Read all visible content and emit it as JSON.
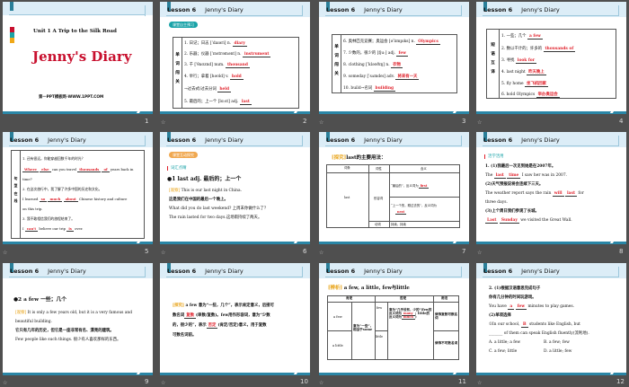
{
  "header": {
    "lesson": "Lesson 6",
    "title": "Jenny's Diary"
  },
  "slide_numbers": [
    "1",
    "2",
    "3",
    "4",
    "5",
    "6",
    "7",
    "8",
    "9",
    "10",
    "11",
    "12"
  ],
  "transition_icon": "☆",
  "colors": {
    "teal": "#2a86a6",
    "answer": "#e0202a",
    "header": "#dcedf7"
  },
  "s1": {
    "unit": "Unit 1  A Trip to the Silk Road",
    "title": "Jenny's Diary",
    "site": "第一PPT模板网-WWW.1PPT.COM"
  },
  "s2": {
    "badge": "课堂自主预习",
    "side": "单词闯关",
    "rows": [
      {
        "q": "1. 日记；日志 [ˈdaɪəri] n.",
        "a": "diary"
      },
      {
        "q": "2. 乐器；仪器 [ˈɪnstrəmənt] n.",
        "a": "instrument"
      },
      {
        "q": "3. 千 [ˈθaʊznd] num.",
        "a": "thousand"
      },
      {
        "q": "4. 举行；拿着 [həʊld] v.",
        "a": "hold"
      },
      {
        "q": "→过去式/过去分词",
        "a": "held"
      },
      {
        "q": "5. 最后的；上一个 [lɑːst] adj.",
        "a": "last"
      }
    ]
  },
  "s3": {
    "side": "单词闯关",
    "rows": [
      {
        "q": "6. 奥林匹克竞赛；奥运会 [əˈlɪmpɪks] n.",
        "a": "Olympics"
      },
      {
        "q": "7. 少数的，很少的 [fjuː] adj.",
        "a": "few"
      },
      {
        "q": "8. clothing [ˈkləʊðɪŋ] n.",
        "a": "衣物"
      },
      {
        "q": "9. someday [ˈsʌmdeɪ] adv.",
        "a": "将来有一天"
      },
      {
        "q": "10. build→名词",
        "a": "building"
      }
    ]
  },
  "s4": {
    "side": "短语互译",
    "rows": [
      {
        "q": "1. 一些；几个",
        "a": "a few"
      },
      {
        "q": "2. 数以千计的；许多的",
        "a": "thousands of"
      },
      {
        "q": "3. 寻找",
        "a": "look for"
      },
      {
        "q": "4. last night",
        "a": "昨天晚上"
      },
      {
        "q": "5. fly home",
        "a": "坐飞机回家"
      },
      {
        "q": "6. hold Olympics",
        "a": "举办奥运会"
      }
    ]
  },
  "s5": {
    "side": "句型在线",
    "q1": "1. 还有很远，你能穿越回数千年的时光？",
    "a1a": "Where",
    "a1b": "else",
    "q1m": "can you travel",
    "a1c": "thousands",
    "a1d": "of",
    "q1e": "years back in",
    "q1f": "time?",
    "q2": "2. 在这次旅行中，我了解了许多中国的历史和文化。",
    "q2a": "I learned",
    "a2a": "so",
    "a2b": "much",
    "a2c": "about",
    "q2b": "Chinese history and culture",
    "q2c": "on this trip.",
    "q3": "3. 我不敢相信我们的旅程结束了。",
    "q3a": "I",
    "a3a": "can't",
    "q3b": "believe our trip",
    "a3b": "is",
    "q3c": "over."
  },
  "s6": {
    "badge": "课堂互动探究",
    "section": "词汇点睛",
    "head": "●1  last adj. 最后的；上一个",
    "tag": "[观察]",
    "l1": "This is our last night in China.",
    "l2": "这是我们在中国的最后一个晚上。",
    "l3": "What did you do last weekend? 上周末你做什么了？",
    "l4": "The rain lasted for two days.这场雨持续了两天。"
  },
  "s7": {
    "tag": "[探究]",
    "head": "last的主要用法：",
    "th": [
      "词条",
      "词性",
      "含义"
    ],
    "word": "last",
    "pos1": "形容词",
    "m1": "“最后的”，反义词为",
    "a1": "first",
    "m2": "“上一个的，刚过去的”，反义词为",
    "a2": "next",
    "pos2": "动词",
    "m3": "持续，持续"
  },
  "s8": {
    "section": "活学活用",
    "l1": "1. (1)我最后一次见到她是在2007年。",
    "l2a": "The",
    "a1": "last",
    "a2": "time",
    "l2b": "I saw her was in 2007.",
    "l3": "(2)天气预报说将会连续下三天。",
    "l4a": "The weather report says the rain",
    "a3": "will",
    "a4": "last",
    "l4b": "for",
    "l5": "three days.",
    "l6": "(3)上个周日我们参观了长城。",
    "a5": "Last",
    "a6": "Sunday",
    "l7": "we visited the Great Wall."
  },
  "s9": {
    "head": "●2  a few 一些；几个",
    "tag": "[观察]",
    "l1": "It is only a few years old, but it is a very famous and",
    "l2": "beautiful building.",
    "l3": "它只有几年的历史，但它是一座非常有名、漂亮的建筑。",
    "l4": "Few people like such things. 很少有人喜欢那样的东西。"
  },
  "s10": {
    "tag": "[探究]",
    "l1": "a few 意为“一些，几个”，表示肯定意义，后接可",
    "l2a": "数名词",
    "a1": "复数",
    "l2b": "(单数/复数)。few用作形容词，意为“少数",
    "l3a": "的，很少的”，表示",
    "a2": "否定",
    "l3b": "(肯定/否定)意义，用于复数",
    "l4": "可数名词前。"
  },
  "s11": {
    "tag": "[辨析]",
    "head": "a few, a little, few与little",
    "th": [
      "肯定",
      "否定",
      "用法"
    ],
    "afew": "a few",
    "alittle": "a little",
    "pos": "意为“一些”，相当于some",
    "few": "few",
    "little": "little",
    "neg1": "意为“几乎没有，少的”(few的反义",
    "neg2": "词为",
    "a1": "many",
    "neg3": "；little的反义词为",
    "a2": "much",
    "u1": "修饰复数可数名词",
    "u2": "修饰不可数名词"
  },
  "s12": {
    "l1": "2. (1)根据汉语意思完成句子",
    "l2": "你有几分钟的时间玩游戏。",
    "l3a": "You have",
    "a1": "a",
    "a2": "few",
    "l3b": "minutes to play games.",
    "l4": "(2)单项选择",
    "l5a": "①In our school,",
    "a3": "B",
    "l5b": "students like English, but",
    "l6": "_______ of them can speak English fluently(流利地).",
    "opts": [
      "A. a little; a few",
      "B. a few; few",
      "C. a few; little",
      "D. a little; few"
    ]
  }
}
